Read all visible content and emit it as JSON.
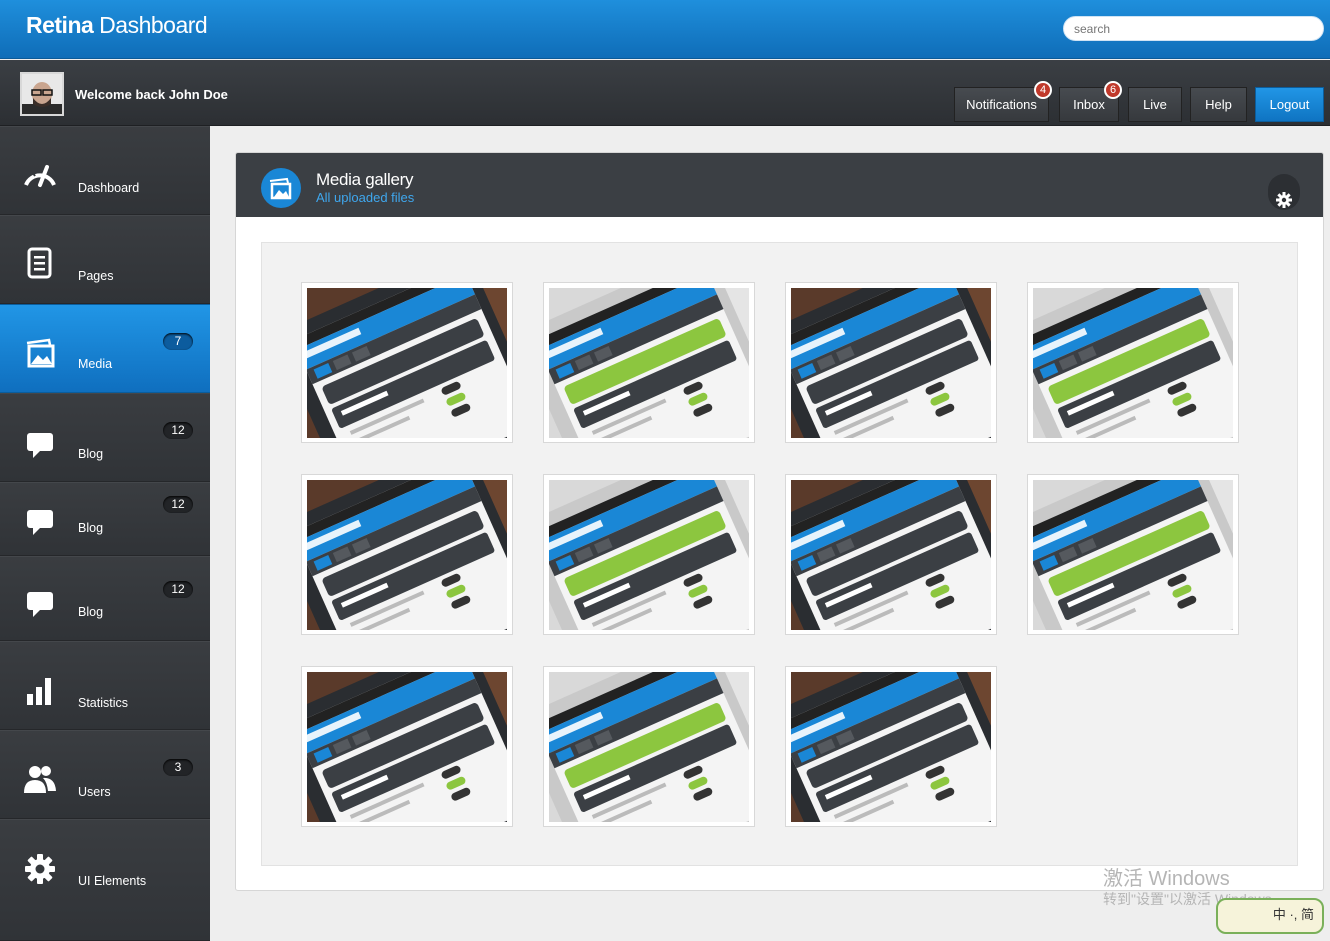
{
  "topbar": {
    "brand_bold": "Retina",
    "brand_rest": " Dashboard",
    "search_placeholder": "search"
  },
  "userbar": {
    "welcome": "Welcome back John Doe",
    "buttons": [
      {
        "label": "Notifications",
        "badge": "4"
      },
      {
        "label": "Inbox",
        "badge": "6"
      },
      {
        "label": "Live"
      },
      {
        "label": "Help"
      },
      {
        "label": "Logout"
      }
    ]
  },
  "sidebar": {
    "items": [
      {
        "label": "Dashboard",
        "icon": "speedometer-icon"
      },
      {
        "label": "Pages",
        "icon": "document-icon"
      },
      {
        "label": "Media",
        "icon": "image-icon",
        "badge": "7",
        "active": true
      },
      {
        "label": "Blog",
        "icon": "chat-bubble-icon",
        "badge": "12"
      },
      {
        "label": "Blog",
        "icon": "chat-bubble-icon",
        "badge": "12"
      },
      {
        "label": "Blog",
        "icon": "chat-bubble-icon",
        "badge": "12"
      },
      {
        "label": "Statistics",
        "icon": "bar-chart-icon"
      },
      {
        "label": "Users",
        "icon": "users-icon",
        "badge": "3"
      },
      {
        "label": "UI Elements",
        "icon": "gear-icon"
      }
    ]
  },
  "panel": {
    "title": "Media gallery",
    "subtitle": "All uploaded files"
  },
  "gallery": {
    "thumbnails": [
      {
        "variant": "dark"
      },
      {
        "variant": "light"
      },
      {
        "variant": "dark"
      },
      {
        "variant": "light"
      },
      {
        "variant": "dark"
      },
      {
        "variant": "light"
      },
      {
        "variant": "dark"
      },
      {
        "variant": "light"
      },
      {
        "variant": "dark"
      },
      {
        "variant": "light"
      },
      {
        "variant": "dark"
      }
    ]
  },
  "watermark": {
    "line1": "激活 Windows",
    "line2": "转到\"设置\"以激活 Windows。",
    "ime": "中 ·, 简"
  },
  "colors": {
    "accent": "#1a87d6",
    "badge_red": "#c0392b",
    "sidebar": "#35383c"
  }
}
